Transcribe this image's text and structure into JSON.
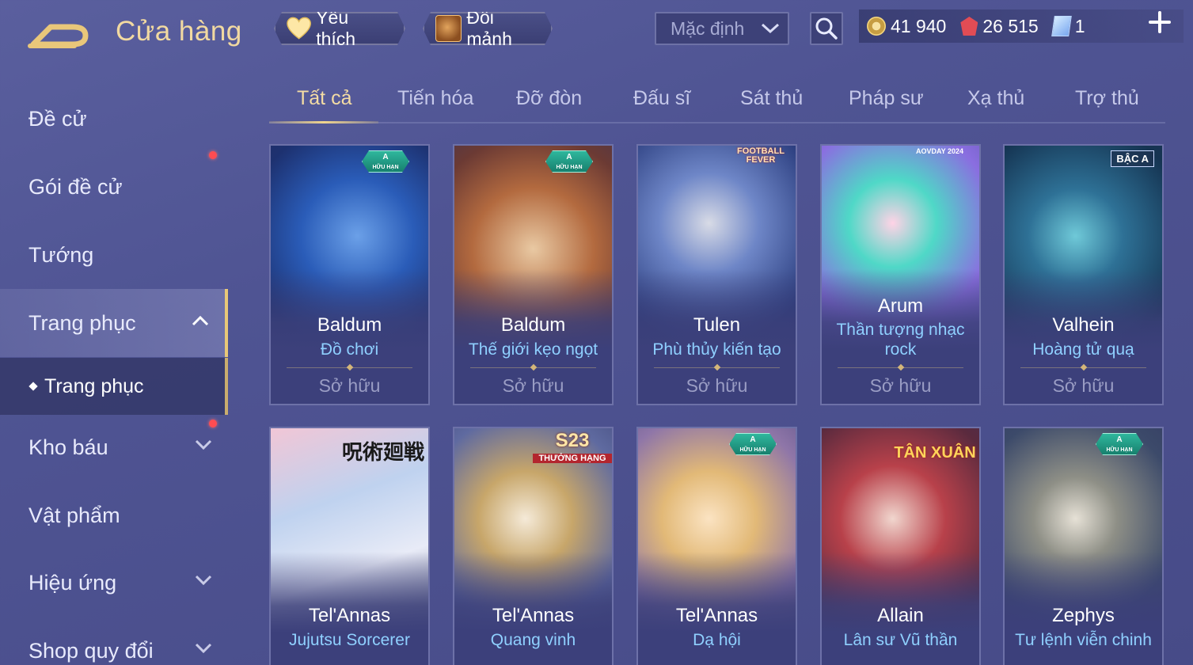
{
  "header": {
    "title": "Cửa hàng",
    "favorite_label": "Yêu thích",
    "exchange_label": "Đổi mảnh",
    "sort_value": "Mặc định",
    "currency": {
      "gold": "41 940",
      "gems": "26 515",
      "vouchers": "1"
    }
  },
  "sidebar": {
    "items": [
      {
        "label": "Đề cử"
      },
      {
        "label": "Gói đề cử"
      },
      {
        "label": "Tướng"
      },
      {
        "label": "Trang phục"
      },
      {
        "label": "Kho báu"
      },
      {
        "label": "Vật phẩm"
      },
      {
        "label": "Hiệu ứng"
      },
      {
        "label": "Shop quy đổi"
      }
    ],
    "sub_item": "Trang phục"
  },
  "tabs": [
    "Tất cả",
    "Tiến hóa",
    "Đỡ đòn",
    "Đấu sĩ",
    "Sát thủ",
    "Pháp sư",
    "Xạ thủ",
    "Trợ thủ"
  ],
  "cards": [
    {
      "hero": "Baldum",
      "skin": "Đồ chơi",
      "status": "Sở hữu",
      "badge": "A",
      "badge_sub": "HỮU HẠN"
    },
    {
      "hero": "Baldum",
      "skin": "Thế giới kẹo ngọt",
      "status": "Sở hữu",
      "badge": "A",
      "badge_sub": "HỮU HẠN"
    },
    {
      "hero": "Tulen",
      "skin": "Phù thủy kiến tạo",
      "status": "Sở hữu",
      "event": "FOOTBALL FEVER"
    },
    {
      "hero": "Arum",
      "skin": "Thần tượng nhạc rock",
      "status": "Sở hữu",
      "event": "AOVDAY 2024"
    },
    {
      "hero": "Valhein",
      "skin": "Hoàng tử quạ",
      "status": "Sở hữu",
      "badge_text": "BẬC A"
    },
    {
      "hero": "Tel'Annas",
      "skin": "Jujutsu Sorcerer",
      "event": "呪術廻戦"
    },
    {
      "hero": "Tel'Annas",
      "skin": "Quang vinh",
      "event": "S23",
      "event_sub": "THƯỞNG HẠNG"
    },
    {
      "hero": "Tel'Annas",
      "skin": "Dạ hội",
      "badge": "A",
      "badge_sub": "HỮU HẠN"
    },
    {
      "hero": "Allain",
      "skin": "Lân sư Vũ thần",
      "event": "TÂN XUÂN"
    },
    {
      "hero": "Zephys",
      "skin": "Tư lệnh viễn chinh",
      "badge": "A",
      "badge_sub": "HỮU HẠN"
    }
  ],
  "colors": {
    "accent_gold": "#f1d9a1",
    "skin_name": "#8fd0ff",
    "notification": "#ff4c52"
  }
}
